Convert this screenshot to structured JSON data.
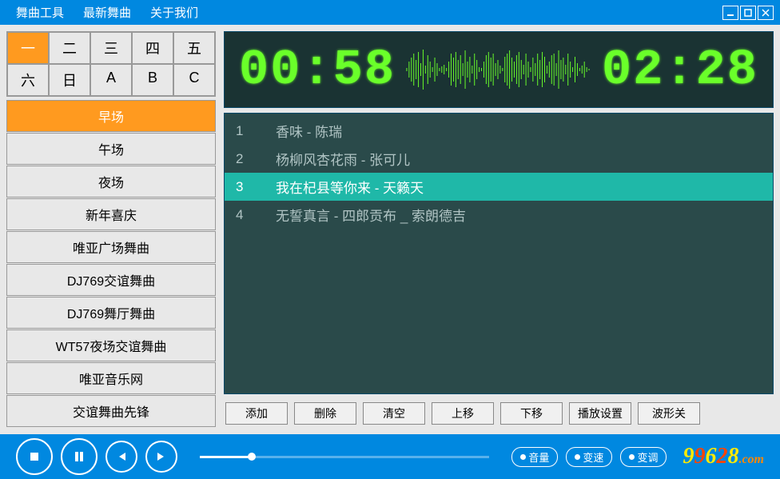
{
  "menu": {
    "items": [
      "舞曲工具",
      "最新舞曲",
      "关于我们"
    ]
  },
  "tabs": {
    "items": [
      "一",
      "二",
      "三",
      "四",
      "五",
      "六",
      "日",
      "A",
      "B",
      "C"
    ],
    "selected": 0
  },
  "categories": {
    "items": [
      "早场",
      "午场",
      "夜场",
      "新年喜庆",
      "唯亚广场舞曲",
      "DJ769交谊舞曲",
      "DJ769舞厅舞曲",
      "WT57夜场交谊舞曲",
      "唯亚音乐网",
      "交谊舞曲先锋"
    ],
    "selected": 0
  },
  "display": {
    "elapsed": "00:58",
    "total": "02:28"
  },
  "playlist": {
    "items": [
      {
        "num": "1",
        "title": "香味 - 陈瑞"
      },
      {
        "num": "2",
        "title": "杨柳风杏花雨 - 张可儿"
      },
      {
        "num": "3",
        "title": "我在杞县等你来 - 天籁天"
      },
      {
        "num": "4",
        "title": "无誓真言 - 四郎贡布 _ 索朗德吉"
      }
    ],
    "selected": 2
  },
  "actions": {
    "add": "添加",
    "delete": "删除",
    "clear": "清空",
    "moveUp": "上移",
    "moveDown": "下移",
    "playSettings": "播放设置",
    "waveOff": "波形关"
  },
  "playbar": {
    "progress": 18,
    "volume": "音量",
    "speed": "变速",
    "pitch": "变调"
  },
  "logo": {
    "text": "99628",
    "suffix": ".com"
  }
}
